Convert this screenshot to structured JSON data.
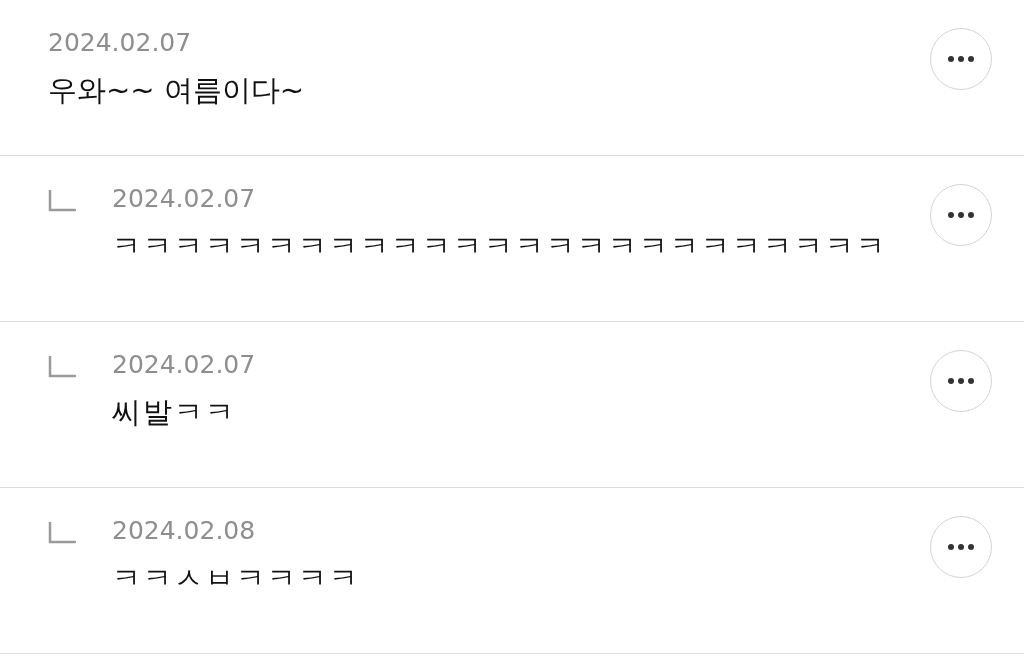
{
  "comments": [
    {
      "date": "2024.02.07",
      "text": "우와~~ 여름이다~",
      "children": [
        {
          "date": "2024.02.07",
          "text": "ㅋㅋㅋㅋㅋㅋㅋㅋㅋㅋㅋㅋㅋㅋㅋㅋㅋㅋㅋㅋㅋㅋㅋㅋㅋ"
        },
        {
          "date": "2024.02.07",
          "text": "씨발ㅋㅋ"
        },
        {
          "date": "2024.02.08",
          "text": "ㅋㅋㅅㅂㅋㅋㅋㅋ"
        }
      ]
    }
  ]
}
